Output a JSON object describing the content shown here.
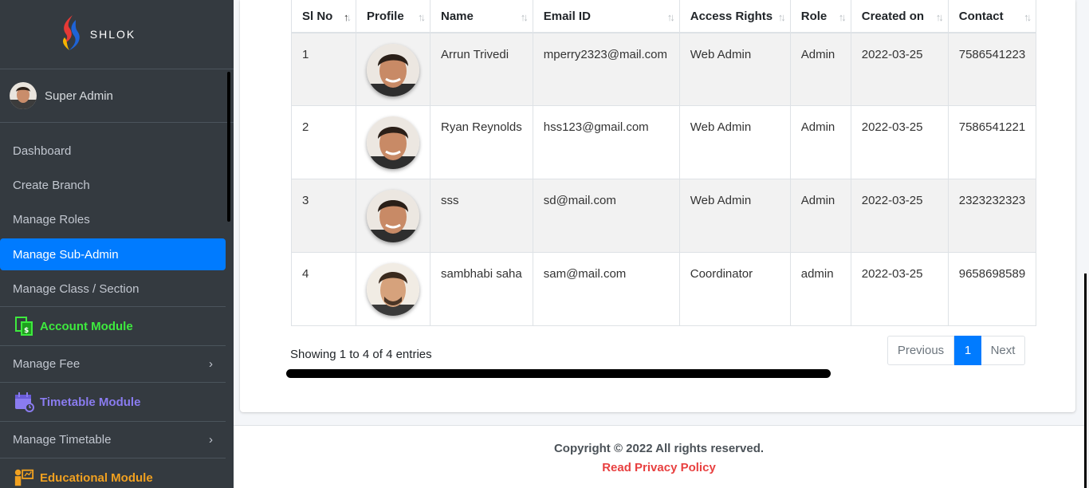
{
  "brand": {
    "name": "SHLOK"
  },
  "user": {
    "name": "Super Admin"
  },
  "nav": [
    {
      "label": "Dashboard"
    },
    {
      "label": "Create Branch"
    },
    {
      "label": "Manage Roles"
    },
    {
      "label": "Manage Sub-Admin",
      "active": true
    },
    {
      "label": "Manage Class / Section"
    }
  ],
  "modules": {
    "account": {
      "title": "Account Module",
      "icon": "account-module-icon",
      "color": "#3eea3e",
      "item": "Manage Fee"
    },
    "timetable": {
      "title": "Timetable Module",
      "icon": "calendar-icon",
      "color": "#8a7cf0",
      "item": "Manage Timetable"
    },
    "educational": {
      "title": "Educational Module",
      "icon": "teacher-board-icon",
      "color": "#f0a020"
    }
  },
  "table": {
    "columns": [
      "Sl No",
      "Profile",
      "Name",
      "Email ID",
      "Access Rights",
      "Role",
      "Created on",
      "Contact"
    ],
    "rows": [
      {
        "sl": "1",
        "name": "Arrun Trivedi",
        "email": "mperry2323@mail.com",
        "access": "Web Admin",
        "role": "Admin",
        "created": "2022-03-25",
        "contact": "7586541223"
      },
      {
        "sl": "2",
        "name": "Ryan Reynolds",
        "email": "hss123@gmail.com",
        "access": "Web Admin",
        "role": "Admin",
        "created": "2022-03-25",
        "contact": "7586541221"
      },
      {
        "sl": "3",
        "name": "sss",
        "email": "sd@mail.com",
        "access": "Web Admin",
        "role": "Admin",
        "created": "2022-03-25",
        "contact": "2323232323"
      },
      {
        "sl": "4",
        "name": "sambhabi saha",
        "email": "sam@mail.com",
        "access": "Coordinator",
        "role": "admin",
        "created": "2022-03-25",
        "contact": "9658698589"
      }
    ]
  },
  "pagination": {
    "info": "Showing 1 to 4 of 4 entries",
    "previous": "Previous",
    "current": "1",
    "next": "Next"
  },
  "footer": {
    "copyright": "Copyright © 2022 All rights reserved.",
    "privacy": "Read Privacy Policy"
  },
  "colors": {
    "sidebar": "#343a40",
    "accent": "#007bff",
    "privacy_link": "#e84040"
  }
}
